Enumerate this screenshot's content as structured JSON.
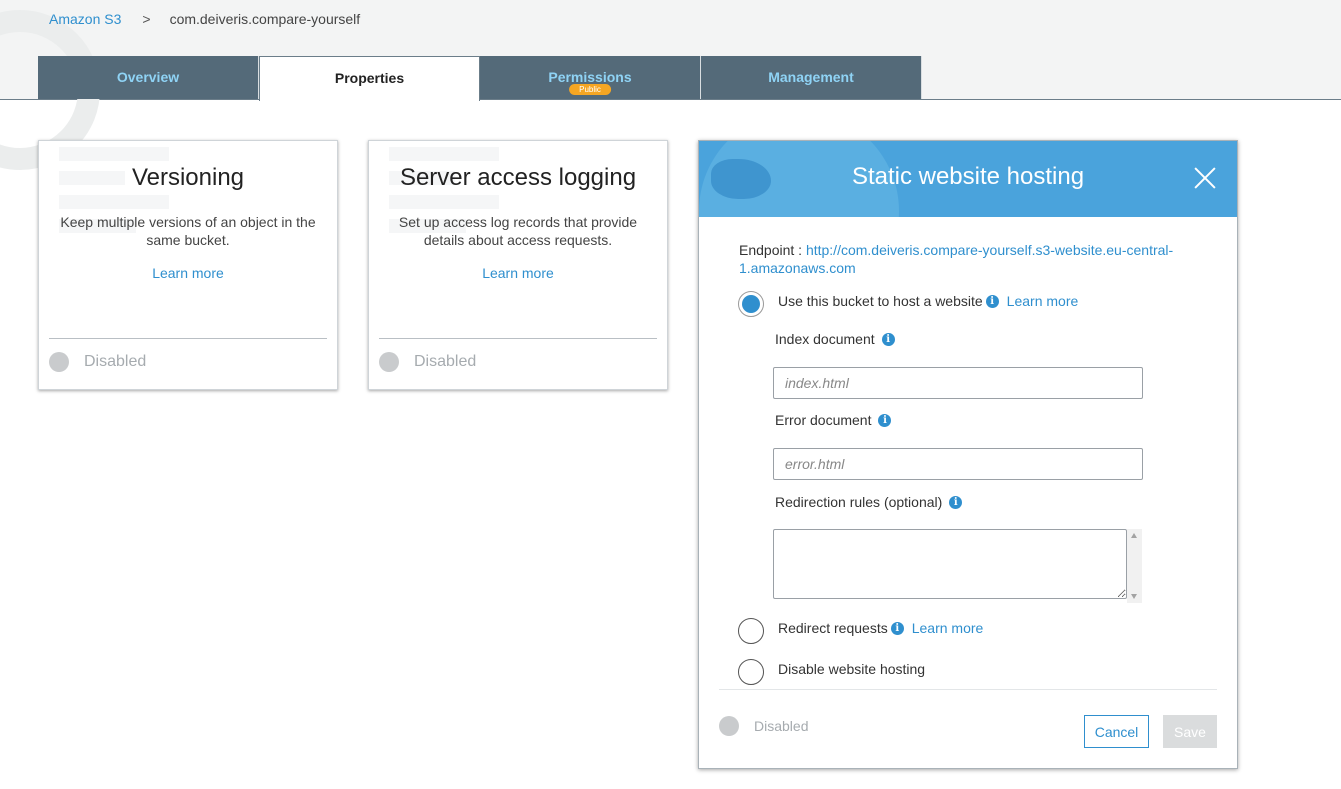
{
  "breadcrumb": {
    "root": "Amazon S3",
    "separator": ">",
    "current": "com.deiveris.compare-yourself"
  },
  "tabs": [
    {
      "label": "Overview",
      "active": false
    },
    {
      "label": "Properties",
      "active": true
    },
    {
      "label": "Permissions",
      "active": false,
      "badge": "Public"
    },
    {
      "label": "Management",
      "active": false
    }
  ],
  "cards": {
    "versioning": {
      "title": "Versioning",
      "description": "Keep multiple versions of an object in the same bucket.",
      "link": "Learn more",
      "status": "Disabled"
    },
    "logging": {
      "title": "Server access logging",
      "description": "Set up access log records that provide details about access requests.",
      "link": "Learn more",
      "status": "Disabled"
    }
  },
  "hosting": {
    "title": "Static website hosting",
    "endpoint_label": "Endpoint : ",
    "endpoint_url": "http://com.deiveris.compare-yourself.s3-website.eu-central-1.amazonaws.com",
    "options": {
      "host": {
        "label": "Use this bucket to host a website",
        "link": "Learn more",
        "selected": true
      },
      "redirect": {
        "label": "Redirect requests",
        "link": "Learn more",
        "selected": false
      },
      "disable": {
        "label": "Disable website hosting",
        "selected": false
      }
    },
    "index_label": "Index document",
    "index_placeholder": "index.html",
    "index_value": "",
    "error_label": "Error document",
    "error_placeholder": "error.html",
    "error_value": "",
    "redirection_label": "Redirection rules (optional)",
    "redirection_value": "",
    "status": "Disabled",
    "cancel_label": "Cancel",
    "save_label": "Save"
  },
  "colors": {
    "accent": "#2f8fce",
    "tab_bg": "#546a79",
    "tab_text": "#8fd3f5",
    "header_bg": "#4aa3dc",
    "badge": "#f5a623"
  },
  "icons": [
    "close-icon",
    "info-icon",
    "chevron-right-icon"
  ]
}
